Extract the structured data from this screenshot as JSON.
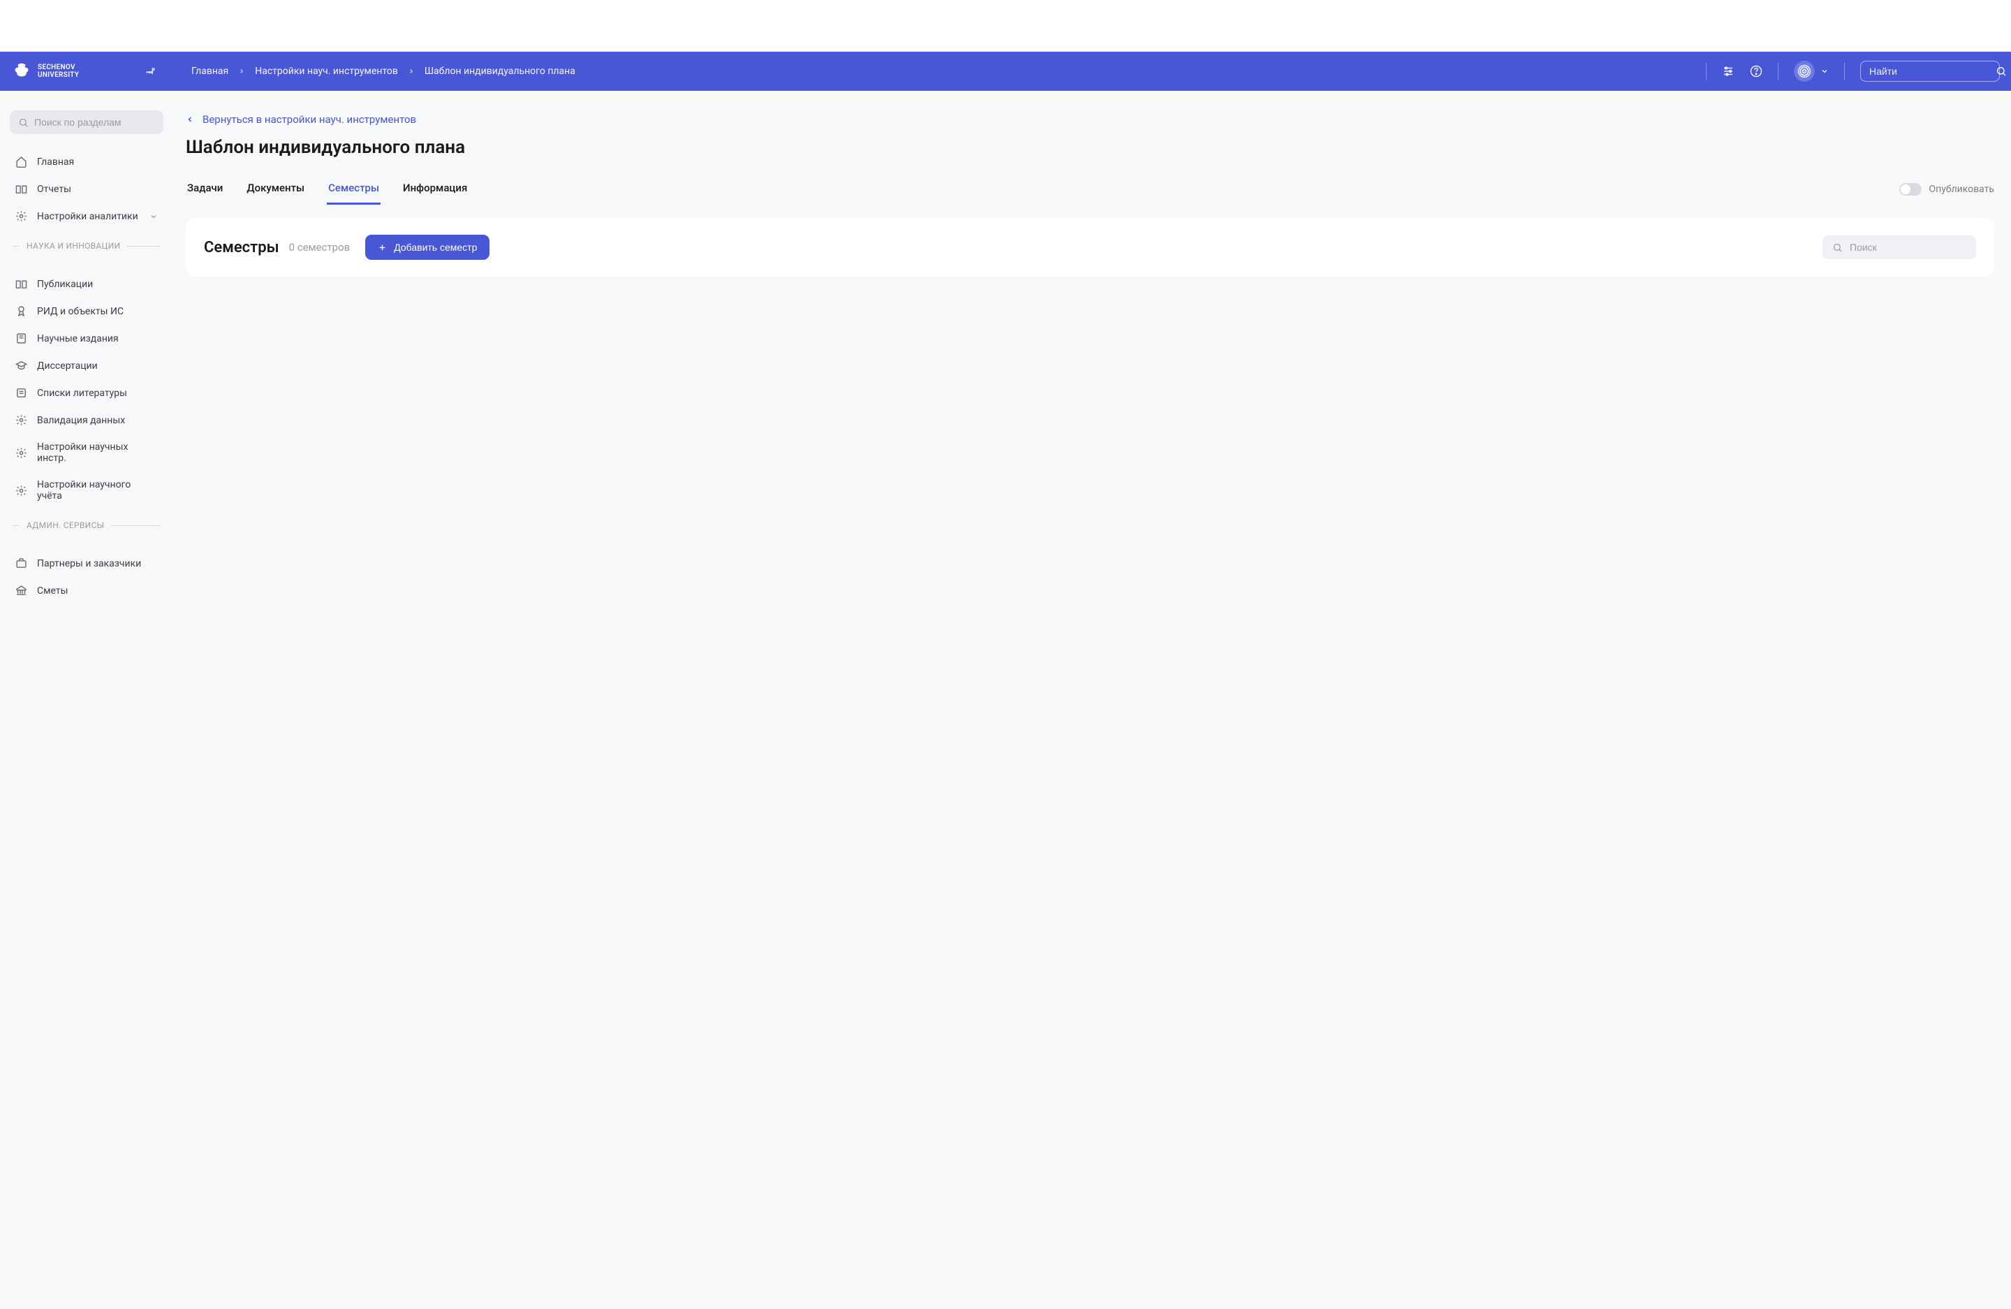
{
  "brand": {
    "name": "SECHENOV",
    "sub": "UNIVERSITY"
  },
  "breadcrumb": [
    "Главная",
    "Настройки науч. инструментов",
    "Шаблон индивидуального плана"
  ],
  "top_search_placeholder": "Найти",
  "sidebar": {
    "search_placeholder": "Поиск по разделам",
    "items_top": [
      {
        "label": "Главная",
        "icon": "home"
      },
      {
        "label": "Отчеты",
        "icon": "book"
      },
      {
        "label": "Настройки аналитики",
        "icon": "gear",
        "expandable": true
      }
    ],
    "section1": "НАУКА И ИННОВАЦИИ",
    "items_science": [
      {
        "label": "Публикации",
        "icon": "book"
      },
      {
        "label": "РИД и объекты ИС",
        "icon": "award"
      },
      {
        "label": "Научные издания",
        "icon": "journal"
      },
      {
        "label": "Диссертации",
        "icon": "grad"
      },
      {
        "label": "Списки литературы",
        "icon": "list"
      },
      {
        "label": "Валидация данных",
        "icon": "gear"
      },
      {
        "label": "Настройки научных инстр.",
        "icon": "gear"
      },
      {
        "label": "Настройки научного учёта",
        "icon": "gear"
      }
    ],
    "section2": "АДМИН. СЕРВИСЫ",
    "items_admin": [
      {
        "label": "Партнеры и заказчики",
        "icon": "briefcase"
      },
      {
        "label": "Сметы",
        "icon": "bank"
      }
    ]
  },
  "main": {
    "back_label": "Вернуться в настройки науч. инструментов",
    "title": "Шаблон индивидуального плана",
    "tabs": [
      "Задачи",
      "Документы",
      "Семестры",
      "Информация"
    ],
    "active_tab_index": 2,
    "publish_label": "Опубликовать",
    "card": {
      "title": "Семестры",
      "count_text": "0 семестров",
      "add_btn": "Добавить семестр",
      "search_placeholder": "Поиск"
    }
  },
  "colors": {
    "accent": "#4757d6"
  }
}
